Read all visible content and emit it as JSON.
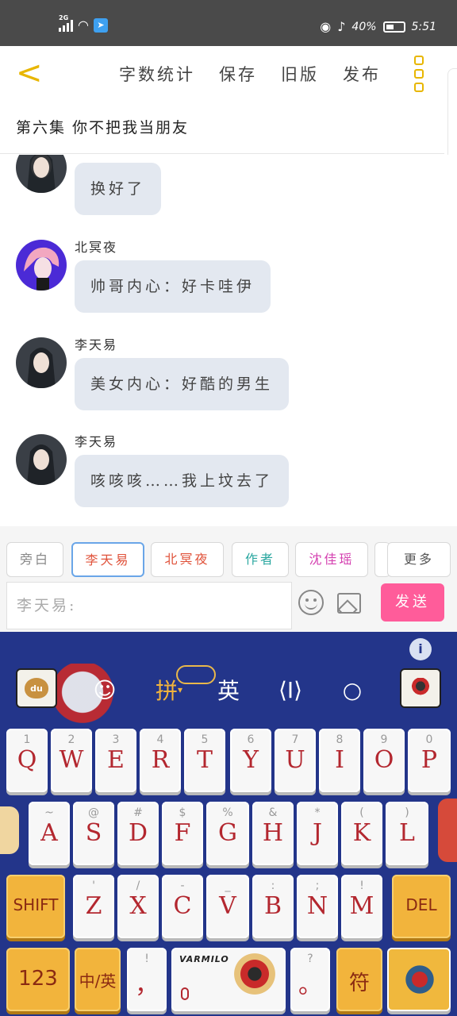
{
  "status_bar": {
    "network": "2G",
    "battery": "40%",
    "time": "5:51"
  },
  "top_bar": {
    "menu": [
      "字数统计",
      "保存",
      "旧版",
      "发布"
    ]
  },
  "chapter_title": "第六集 你不把我当朋友",
  "messages": [
    {
      "name": "李天易",
      "text": "换好了",
      "avatar": "girl-dark-hair"
    },
    {
      "name": "北冥夜",
      "text": "帅哥内心：好卡哇伊",
      "avatar": "boy-pink-hair"
    },
    {
      "name": "李天易",
      "text": "美女内心：好酷的男生",
      "avatar": "girl-dark-hair"
    },
    {
      "name": "李天易",
      "text": "咳咳咳……我上坟去了",
      "avatar": "girl-dark-hair"
    }
  ],
  "roles": [
    {
      "label": "旁白",
      "color": "#888888",
      "selected": false
    },
    {
      "label": "李天易",
      "color": "#e0523a",
      "selected": true
    },
    {
      "label": "北冥夜",
      "color": "#e0523a",
      "selected": false
    },
    {
      "label": "作者",
      "color": "#2aa7a0",
      "selected": false
    },
    {
      "label": "沈佳瑶",
      "color": "#d43fb0",
      "selected": false
    },
    {
      "label": "更多",
      "color": "#555555",
      "selected": false
    }
  ],
  "composer": {
    "placeholder": "李天易:",
    "send_label": "发送"
  },
  "keyboard": {
    "toolbar": {
      "pinyin": "拼",
      "english": "英"
    },
    "du_label": "du",
    "row1": [
      {
        "top": "1",
        "main": "Q"
      },
      {
        "top": "2",
        "main": "W"
      },
      {
        "top": "3",
        "main": "E"
      },
      {
        "top": "4",
        "main": "R"
      },
      {
        "top": "5",
        "main": "T"
      },
      {
        "top": "6",
        "main": "Y"
      },
      {
        "top": "7",
        "main": "U"
      },
      {
        "top": "8",
        "main": "I"
      },
      {
        "top": "9",
        "main": "O"
      },
      {
        "top": "0",
        "main": "P"
      }
    ],
    "row2": [
      {
        "top": "~",
        "main": "A"
      },
      {
        "top": "@",
        "main": "S"
      },
      {
        "top": "#",
        "main": "D"
      },
      {
        "top": "$",
        "main": "F"
      },
      {
        "top": "%",
        "main": "G"
      },
      {
        "top": "&",
        "main": "H"
      },
      {
        "top": "*",
        "main": "J"
      },
      {
        "top": "(",
        "main": "K"
      },
      {
        "top": ")",
        "main": "L"
      }
    ],
    "row3": [
      {
        "top": "'",
        "main": "Z"
      },
      {
        "top": "/",
        "main": "X"
      },
      {
        "top": "-",
        "main": "C"
      },
      {
        "top": "_",
        "main": "V"
      },
      {
        "top": ":",
        "main": "B"
      },
      {
        "top": ";",
        "main": "N"
      },
      {
        "top": "!",
        "main": "M"
      }
    ],
    "shift_label": "SHIFT",
    "del_label": "DEL",
    "num_label": "123",
    "lang_label": "中/英",
    "comma_key": "，",
    "comma_top": "!",
    "brand": "VARMILO",
    "period_key": "。",
    "period_top": "?",
    "symbol_label": "符"
  }
}
